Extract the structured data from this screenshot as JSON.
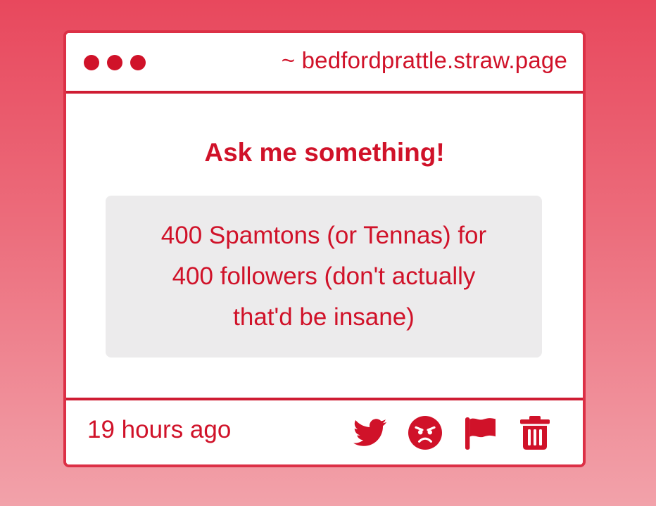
{
  "window": {
    "url": "~ bedfordprattle.straw.page"
  },
  "post": {
    "heading": "Ask me something!",
    "question_lines": [
      "400 Spamtons (or Tennas) for",
      "400 followers (don't actually",
      "that'd be insane)"
    ],
    "timestamp": "19 hours ago"
  },
  "actions": [
    {
      "icon": "twitter-icon"
    },
    {
      "icon": "angry-face-icon"
    },
    {
      "icon": "flag-icon"
    },
    {
      "icon": "trash-icon"
    }
  ],
  "colors": {
    "accent": "#d01229",
    "border": "#dc3046",
    "question_bg": "#ecebec",
    "bg_top": "#e8485d",
    "bg_bottom": "#f2a2aa"
  }
}
